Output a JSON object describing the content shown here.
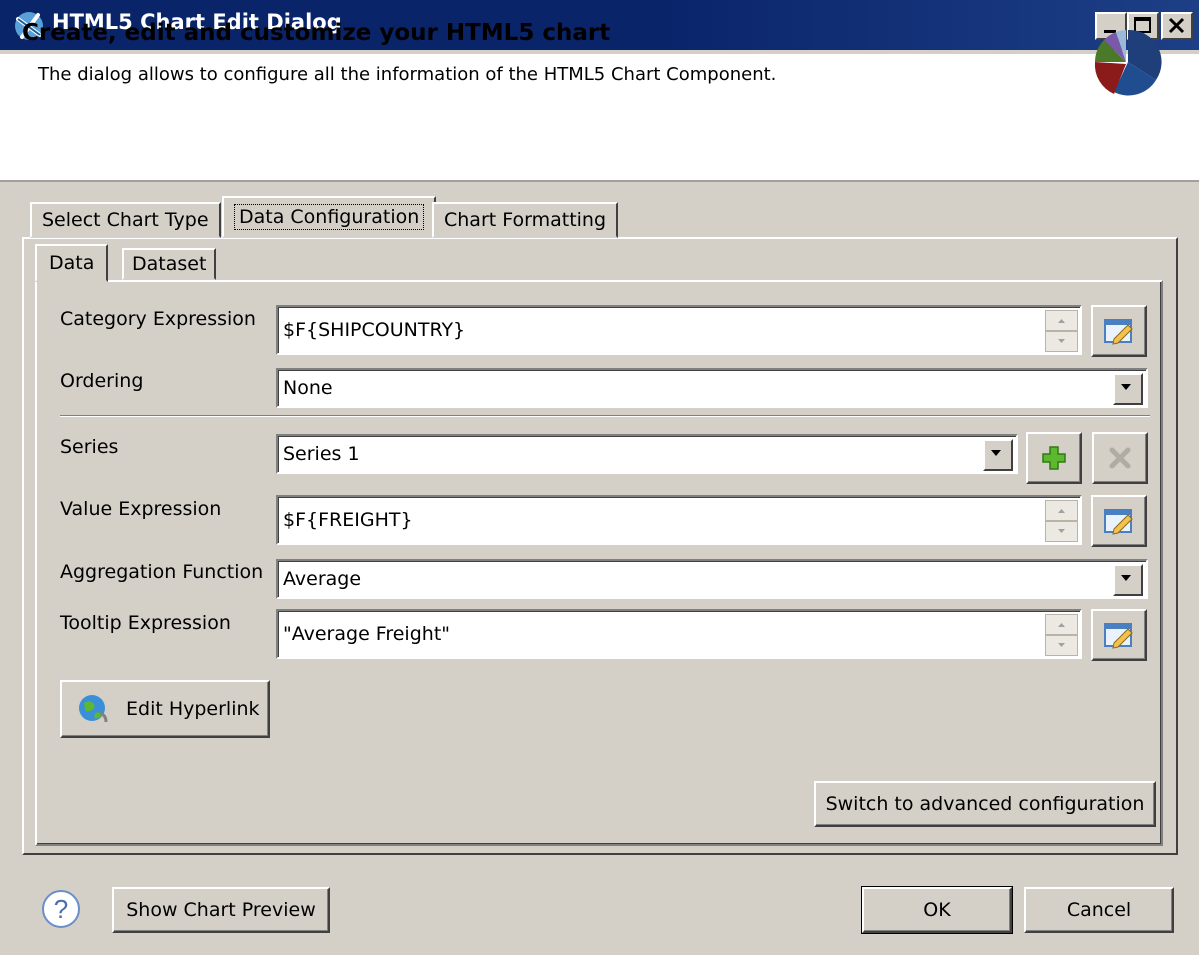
{
  "window": {
    "title": "HTML5 Chart Edit Dialog",
    "app_icon": "jaspersoft-icon",
    "buttons": {
      "minimize": "minimize-icon",
      "maximize": "maximize-icon",
      "close": "close-icon"
    }
  },
  "header": {
    "title": "Create, edit and customize your HTML5 chart",
    "description": "The dialog allows to configure all the information of the HTML5 Chart Component.",
    "icon": "pie-chart-icon"
  },
  "tabs": [
    {
      "label": "Select Chart Type",
      "active": false
    },
    {
      "label": "Data Configuration",
      "active": true
    },
    {
      "label": "Chart Formatting",
      "active": false
    }
  ],
  "subtabs": [
    {
      "label": "Data",
      "active": true
    },
    {
      "label": "Dataset",
      "active": false
    }
  ],
  "form": {
    "category_expression": {
      "label": "Category Expression",
      "value": "$F{SHIPCOUNTRY}"
    },
    "ordering": {
      "label": "Ordering",
      "value": "None"
    },
    "series": {
      "label": "Series",
      "value": "Series 1"
    },
    "value_expression": {
      "label": "Value Expression",
      "value": "$F{FREIGHT}"
    },
    "aggregation_function": {
      "label": "Aggregation Function",
      "value": "Average"
    },
    "tooltip_expression": {
      "label": "Tooltip Expression",
      "value": "\"Average Freight\""
    }
  },
  "edit_hyperlink_label": "Edit Hyperlink",
  "switch_advanced_label": "Switch to advanced configuration",
  "footer": {
    "help_icon": "help-icon",
    "show_preview_label": "Show Chart Preview",
    "ok_label": "OK",
    "cancel_label": "Cancel"
  },
  "colors": {
    "titlebar": "#0a246a",
    "dialog_bg": "#d4d0c8",
    "header_bg": "#ffffff"
  }
}
